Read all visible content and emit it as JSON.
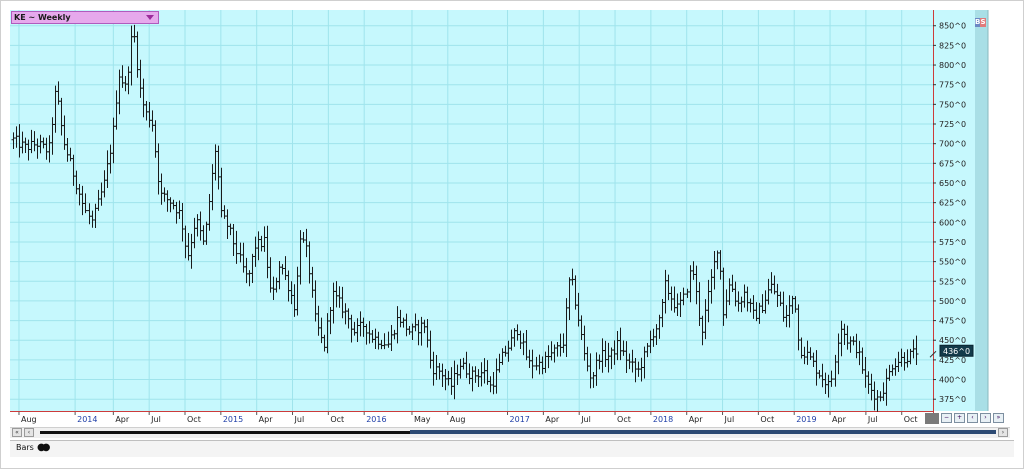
{
  "symbol": {
    "label": "KE ~ Weekly"
  },
  "badge": {
    "b": "B",
    "s": "S"
  },
  "last_price": {
    "label": "436^0",
    "value": 436
  },
  "status": {
    "bars_label": "Bars"
  },
  "colors": {
    "plot_bg": "#c6f8fd",
    "grid": "#9fe4ec",
    "bar": "#1a1a1a",
    "axis_red": "#cc3b3b",
    "right_strip": "#a9dfe6",
    "year_label": "#1f3fa8"
  },
  "chart_data": {
    "type": "ohlc",
    "title": "KE ~ Weekly",
    "xlabel": "",
    "ylabel": "",
    "ylim": [
      360,
      870
    ],
    "price_format": "{v}^0",
    "y_ticks": [
      375,
      400,
      425,
      450,
      475,
      500,
      525,
      550,
      575,
      600,
      625,
      650,
      675,
      700,
      725,
      750,
      775,
      800,
      825,
      850
    ],
    "x_ticks": [
      {
        "label": "Aug",
        "t": 0.5,
        "year": false
      },
      {
        "label": "2014",
        "t": 5.2,
        "year": true
      },
      {
        "label": "Apr",
        "t": 8.4,
        "year": false
      },
      {
        "label": "Jul",
        "t": 11.4,
        "year": false
      },
      {
        "label": "Oct",
        "t": 14.4,
        "year": false
      },
      {
        "label": "2015",
        "t": 17.4,
        "year": true
      },
      {
        "label": "Apr",
        "t": 20.4,
        "year": false
      },
      {
        "label": "Jul",
        "t": 23.4,
        "year": false
      },
      {
        "label": "Oct",
        "t": 26.4,
        "year": false
      },
      {
        "label": "2016",
        "t": 29.4,
        "year": true
      },
      {
        "label": "May",
        "t": 33.4,
        "year": false
      },
      {
        "label": "Aug",
        "t": 36.4,
        "year": false
      },
      {
        "label": "2017",
        "t": 41.4,
        "year": true
      },
      {
        "label": "Apr",
        "t": 44.4,
        "year": false
      },
      {
        "label": "Jul",
        "t": 47.4,
        "year": false
      },
      {
        "label": "Oct",
        "t": 50.4,
        "year": false
      },
      {
        "label": "2018",
        "t": 53.4,
        "year": true
      },
      {
        "label": "Apr",
        "t": 56.4,
        "year": false
      },
      {
        "label": "Jul",
        "t": 59.4,
        "year": false
      },
      {
        "label": "Oct",
        "t": 62.4,
        "year": false
      },
      {
        "label": "2019",
        "t": 65.4,
        "year": true
      },
      {
        "label": "Apr",
        "t": 68.4,
        "year": false
      },
      {
        "label": "Jul",
        "t": 71.4,
        "year": false
      },
      {
        "label": "Oct",
        "t": 74.4,
        "year": false
      }
    ],
    "t_range": [
      0,
      76.6
    ],
    "anchors": [
      [
        0,
        705
      ],
      [
        1,
        695
      ],
      [
        2,
        700
      ],
      [
        3,
        690
      ],
      [
        3.6,
        770
      ],
      [
        4.2,
        705
      ],
      [
        5,
        665
      ],
      [
        6,
        615
      ],
      [
        6.6,
        600
      ],
      [
        7.6,
        650
      ],
      [
        8.3,
        710
      ],
      [
        8.8,
        790
      ],
      [
        9.4,
        770
      ],
      [
        10,
        850
      ],
      [
        10.6,
        770
      ],
      [
        11,
        740
      ],
      [
        11.6,
        730
      ],
      [
        12.3,
        635
      ],
      [
        13.3,
        625
      ],
      [
        14,
        610
      ],
      [
        14.6,
        555
      ],
      [
        15.3,
        605
      ],
      [
        16,
        570
      ],
      [
        17,
        700
      ],
      [
        17.4,
        610
      ],
      [
        18,
        595
      ],
      [
        19,
        550
      ],
      [
        19.6,
        525
      ],
      [
        20.2,
        570
      ],
      [
        21,
        575
      ],
      [
        21.6,
        500
      ],
      [
        22.3,
        550
      ],
      [
        23,
        520
      ],
      [
        23.6,
        490
      ],
      [
        24,
        585
      ],
      [
        24.6,
        560
      ],
      [
        25.3,
        475
      ],
      [
        26,
        440
      ],
      [
        26.7,
        510
      ],
      [
        27.4,
        495
      ],
      [
        28,
        480
      ],
      [
        28.6,
        460
      ],
      [
        29.4,
        470
      ],
      [
        30,
        455
      ],
      [
        31.4,
        445
      ],
      [
        32.2,
        480
      ],
      [
        33.2,
        460
      ],
      [
        34.4,
        470
      ],
      [
        35,
        415
      ],
      [
        35.8,
        410
      ],
      [
        36.6,
        390
      ],
      [
        37.4,
        420
      ],
      [
        38.4,
        405
      ],
      [
        39.4,
        410
      ],
      [
        40,
        390
      ],
      [
        41,
        430
      ],
      [
        41.6,
        445
      ],
      [
        42.2,
        465
      ],
      [
        43.2,
        420
      ],
      [
        44.2,
        420
      ],
      [
        45.2,
        435
      ],
      [
        46,
        445
      ],
      [
        46.6,
        535
      ],
      [
        47.2,
        485
      ],
      [
        47.8,
        430
      ],
      [
        48.4,
        400
      ],
      [
        49,
        430
      ],
      [
        50,
        430
      ],
      [
        50.6,
        445
      ],
      [
        51.6,
        420
      ],
      [
        52.3,
        410
      ],
      [
        53,
        435
      ],
      [
        53.6,
        460
      ],
      [
        54.2,
        475
      ],
      [
        54.6,
        520
      ],
      [
        55.6,
        490
      ],
      [
        56.2,
        505
      ],
      [
        56.8,
        545
      ],
      [
        57.6,
        460
      ],
      [
        58.2,
        510
      ],
      [
        59,
        575
      ],
      [
        59.4,
        485
      ],
      [
        60,
        525
      ],
      [
        60.6,
        495
      ],
      [
        61.2,
        510
      ],
      [
        62,
        480
      ],
      [
        62.6,
        490
      ],
      [
        63.4,
        520
      ],
      [
        64,
        505
      ],
      [
        64.6,
        475
      ],
      [
        65.4,
        510
      ],
      [
        65.8,
        440
      ],
      [
        66.6,
        430
      ],
      [
        67.4,
        410
      ],
      [
        68.4,
        390
      ],
      [
        69.2,
        470
      ],
      [
        69.8,
        450
      ],
      [
        70.6,
        440
      ],
      [
        71.4,
        395
      ],
      [
        72.4,
        375
      ],
      [
        73,
        395
      ],
      [
        73.6,
        420
      ],
      [
        74.2,
        425
      ],
      [
        75,
        430
      ],
      [
        75.6,
        436
      ]
    ]
  }
}
